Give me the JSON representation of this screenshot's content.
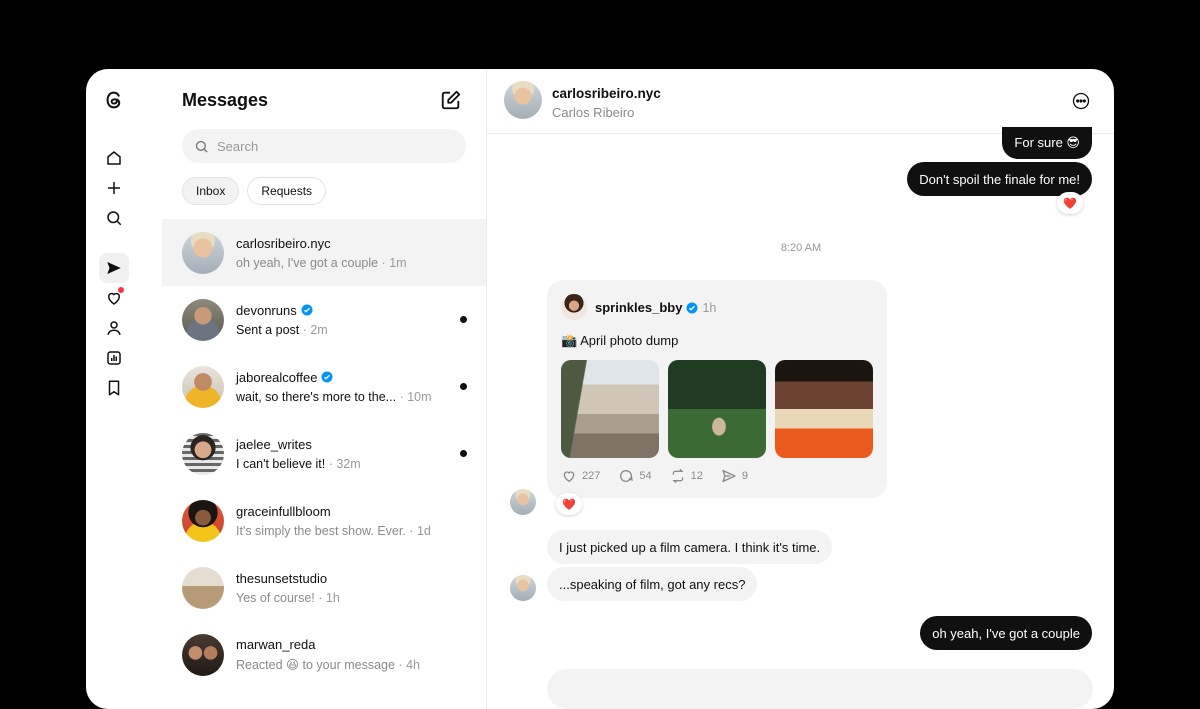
{
  "inbox": {
    "title": "Messages",
    "search_placeholder": "Search",
    "filters": [
      "Inbox",
      "Requests"
    ],
    "conversations": [
      {
        "name": "carlosribeiro.nyc",
        "preview": "oh yeah, I've got a couple",
        "time": "1m",
        "verified": false,
        "unread": false,
        "active": true
      },
      {
        "name": "devonruns",
        "preview": "Sent a post",
        "time": "2m",
        "verified": true,
        "unread": true,
        "active": false
      },
      {
        "name": "jaborealcoffee",
        "preview": "wait, so there's more to the...",
        "time": "10m",
        "verified": true,
        "unread": true,
        "active": false
      },
      {
        "name": "jaelee_writes",
        "preview": "I can't believe it!",
        "time": "32m",
        "verified": false,
        "unread": true,
        "active": false
      },
      {
        "name": "graceinfullbloom",
        "preview": "It's simply the best show. Ever.",
        "time": "1d",
        "verified": false,
        "unread": false,
        "active": false
      },
      {
        "name": "thesunsetstudio",
        "preview": "Yes of course!",
        "time": "1h",
        "verified": false,
        "unread": false,
        "active": false
      },
      {
        "name": "marwan_reda",
        "preview": "Reacted 😆 to your message",
        "time": "4h",
        "verified": false,
        "unread": false,
        "active": false
      }
    ]
  },
  "chat": {
    "username": "carlosribeiro.nyc",
    "full_name": "Carlos Ribeiro",
    "messages": {
      "m1": "For sure 😎",
      "m2": "Don't spoil the finale for me!",
      "m2_reaction": "❤️",
      "timestamp": "8:20 AM",
      "post_reaction": "❤️",
      "m3": "I just picked up a film camera. I think it's time.",
      "m4": "...speaking of film, got any recs?",
      "m5": "oh yeah, I've got a couple"
    },
    "shared_post": {
      "author": "sprinkles_bby",
      "time": "1h",
      "caption": "📸 April photo dump",
      "likes": "227",
      "replies": "54",
      "reposts": "12",
      "shares": "9"
    }
  },
  "colors": {
    "background": "#000000",
    "surface": "#ffffff",
    "bubble_out": "#101010",
    "bubble_in": "#f3f3f3",
    "verified": "#0095f6",
    "notification": "#ff3040"
  }
}
